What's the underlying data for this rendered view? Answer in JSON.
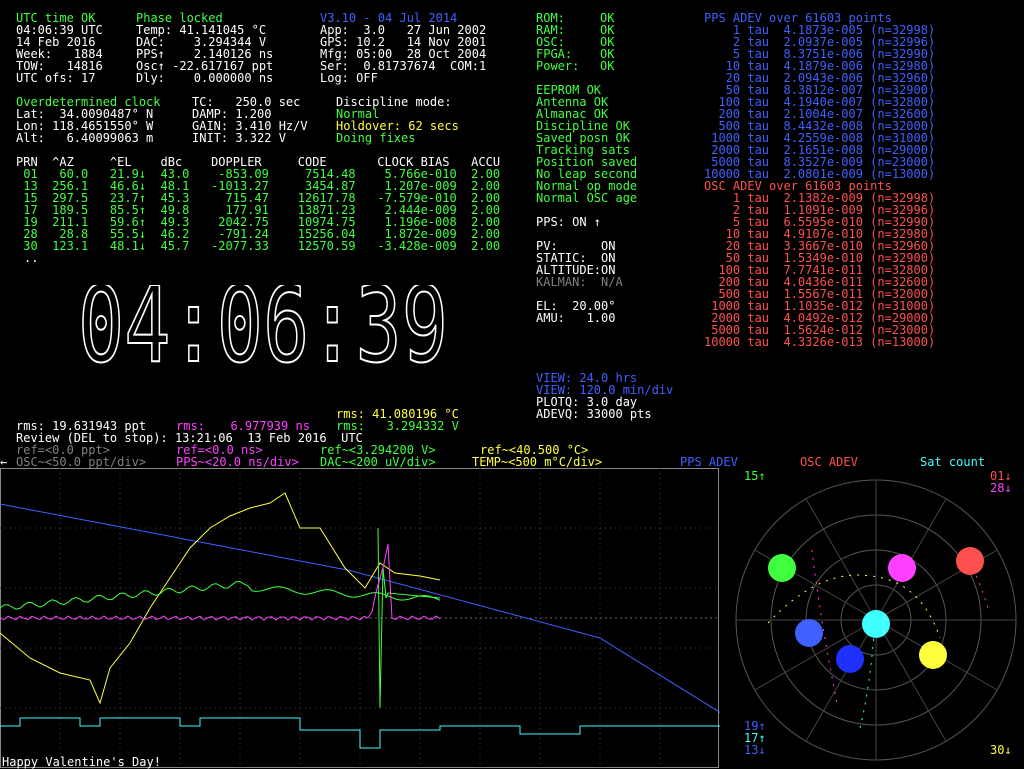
{
  "status_rows": [
    {
      "cols": [
        {
          "t": "UTC time OK",
          "c": "g"
        },
        {
          "t": "Phase locked",
          "c": "g"
        },
        {
          "t": "V3.10 - 04 Jul 2014",
          "c": "b"
        }
      ]
    },
    {
      "cols": [
        {
          "t": "04:06:39 UTC",
          "c": "w"
        },
        {
          "t": "Temp: 41.141045 °C",
          "c": "w"
        },
        {
          "t": "App:  3.0   27 Jun 2002",
          "c": "w"
        }
      ]
    },
    {
      "cols": [
        {
          "t": "14 Feb 2016",
          "c": "w"
        },
        {
          "t": "DAC:    3.294344 V",
          "c": "w"
        },
        {
          "t": "GPS: 10.2   14 Nov 2001",
          "c": "w"
        }
      ]
    },
    {
      "cols": [
        {
          "t": "Week:   1884",
          "c": "w"
        },
        {
          "t": "PPS↑    2.140126 ns",
          "c": "w"
        },
        {
          "t": "Mfg: 05:00  28 Oct 2004",
          "c": "w"
        }
      ]
    },
    {
      "cols": [
        {
          "t": "TOW:   14816",
          "c": "w"
        },
        {
          "t": "Osc↑ -22.617167 ppt",
          "c": "w"
        },
        {
          "t": "Ser:  0.81737674  COM:1",
          "c": "w"
        }
      ]
    },
    {
      "cols": [
        {
          "t": "UTC ofs: 17",
          "c": "w"
        },
        {
          "t": "Dly:    0.000000 ns",
          "c": "w"
        },
        {
          "t": "Log: OFF",
          "c": "w"
        }
      ]
    }
  ],
  "hw_status": [
    {
      "label": "ROM:",
      "value": "OK"
    },
    {
      "label": "RAM:",
      "value": "OK"
    },
    {
      "label": "OSC:",
      "value": "OK"
    },
    {
      "label": "FPGA:",
      "value": "OK"
    },
    {
      "label": "Power:",
      "value": "OK"
    }
  ],
  "flags": [
    "EEPROM OK",
    "Antenna OK",
    "Almanac OK",
    "Discipline OK",
    "Saved posn OK",
    "Tracking sats",
    "Position saved",
    "No leap second",
    "Normal op mode",
    "Normal OSC age"
  ],
  "pps_line": "PPS: ON ↑",
  "mode_lines": [
    {
      "t": "PV:      ON",
      "c": "w"
    },
    {
      "t": "STATIC:  ON",
      "c": "w"
    },
    {
      "t": "ALTITUDE:ON",
      "c": "w"
    },
    {
      "t": "KALMAN:  N/A",
      "c": "gr"
    }
  ],
  "el_line": "EL:  20.00°",
  "amu_line": "AMU:   1.00",
  "view_lines": [
    {
      "t": "VIEW: 24.0 hrs",
      "c": "b"
    },
    {
      "t": "VIEW: 120.0 min/div",
      "c": "b"
    },
    {
      "t": "PLOTQ: 3.0 day",
      "c": "w"
    },
    {
      "t": "ADEVQ: 33000 pts",
      "c": "w"
    }
  ],
  "pps_adev_title": "PPS ADEV over 61603 points",
  "pps_adev": [
    "    1 tau  4.1873e-005 (n=32998)",
    "    2 tau  2.0937e-005 (n=32996)",
    "    5 tau  8.3751e-006 (n=32990)",
    "   10 tau  4.1879e-006 (n=32980)",
    "   20 tau  2.0943e-006 (n=32960)",
    "   50 tau  8.3812e-007 (n=32900)",
    "  100 tau  4.1940e-007 (n=32800)",
    "  200 tau  2.1004e-007 (n=32600)",
    "  500 tau  8.4432e-008 (n=32000)",
    " 1000 tau  4.2559e-008 (n=31000)",
    " 2000 tau  2.1651e-008 (n=29000)",
    " 5000 tau  8.3527e-009 (n=23000)",
    "10000 tau  2.0801e-009 (n=13000)"
  ],
  "osc_adev_title": "OSC ADEV over 61603 points",
  "osc_adev": [
    "    1 tau  2.1382e-009 (n=32998)",
    "    2 tau  1.1091e-009 (n=32996)",
    "    5 tau  6.5595e-010 (n=32990)",
    "   10 tau  4.9107e-010 (n=32980)",
    "   20 tau  3.3667e-010 (n=32960)",
    "   50 tau  1.5349e-010 (n=32900)",
    "  100 tau  7.7741e-011 (n=32800)",
    "  200 tau  4.0436e-011 (n=32600)",
    "  500 tau  1.5567e-011 (n=32000)",
    " 1000 tau  1.1035e-012 (n=31000)",
    " 2000 tau  4.0492e-012 (n=29000)",
    " 5000 tau  1.5624e-012 (n=23000)",
    "10000 tau  4.3326e-013 (n=13000)"
  ],
  "clock_block": [
    {
      "t": "Overdetermined clock",
      "c": "g"
    },
    {
      "t": "Lat:  34.0090487° N",
      "c": "w"
    },
    {
      "t": "Lon: 118.4651550° W",
      "c": "w"
    },
    {
      "t": "Alt:   6.40099063 m",
      "c": "w"
    }
  ],
  "tc_block": [
    {
      "t": "TC:   250.0 sec",
      "c": "w"
    },
    {
      "t": "DAMP: 1.200",
      "c": "w"
    },
    {
      "t": "GAIN: 3.410 Hz/V",
      "c": "w"
    },
    {
      "t": "INIT: 3.322 V",
      "c": "w"
    }
  ],
  "discipline_block": [
    {
      "t": "Discipline mode:",
      "c": "w"
    },
    {
      "t": "Normal",
      "c": "g"
    },
    {
      "t": "Holdover: 62 secs",
      "c": "y"
    },
    {
      "t": "Doing fixes",
      "c": "g"
    }
  ],
  "sat_header": "PRN  ^AZ     ^EL    dBc    DOPPLER     CODE       CLOCK BIAS   ACCU",
  "sat_rows": [
    " 01   60.0   21.9↓  43.0    -853.09     7514.48    5.766e-010  2.00",
    " 13  256.1   46.6↓  48.1   -1013.27     3454.87    1.207e-009  2.00",
    " 15  297.5   23.7↑  45.3     715.47    12617.78   -7.579e-010  2.00",
    " 17  189.5   85.5↑  49.8     177.91    13871.23    2.444e-009  2.00",
    " 19  211.1   59.6↑  49.3    2042.75    10974.75    1.196e-008  2.00",
    " 28   28.8   55.5↓  46.2    -791.24    15256.04    1.872e-009  2.00",
    " 30  123.1   48.1↓  45.7   -2077.33    12570.59   -3.428e-009  2.00"
  ],
  "sat_more": "..",
  "big_clock": "04:06:39",
  "rms_temp_line": "rms: 41.080196 °C",
  "rms_ppt_line": "rms: 19.631943 ppt",
  "rms_ns_label": "rms:",
  "rms_ns_value": "  6.977939 ns",
  "rms_v_line": "rms:   3.294332 V",
  "review_line": "Review (DEL to stop): 13:21:06  13 Feb 2016  UTC",
  "ref_osc": "ref=<0.0 ppt>",
  "ref_pps": "ref=<0.0 ns>",
  "ref_dac": "ref~<3.294200 V>",
  "ref_temp": "ref~<40.500 °C>",
  "scale_osc": "OSC~<50.0 ppt/div>",
  "scale_pps": "PPS~<20.0 ns/div>",
  "scale_dac": "DAC~<200 uV/div>",
  "scale_temp": "TEMP~<500 m°C/div>",
  "legend_pps": "PPS ADEV",
  "legend_osc": "OSC ADEV",
  "legend_sat": "Sat count",
  "footer": "Happy Valentine's Day!",
  "sky_labels": {
    "l15": "15↑",
    "l01": "01↓",
    "l28": "28↓",
    "l19": "19↑",
    "l17": "17↑",
    "l13": "13↓",
    "l30": "30↓"
  },
  "colors": {
    "green": "#40ff40",
    "yellow": "#ffff40",
    "blue": "#4060ff",
    "red": "#ff5050",
    "magenta": "#ff40ff",
    "cyan": "#40ffff"
  }
}
